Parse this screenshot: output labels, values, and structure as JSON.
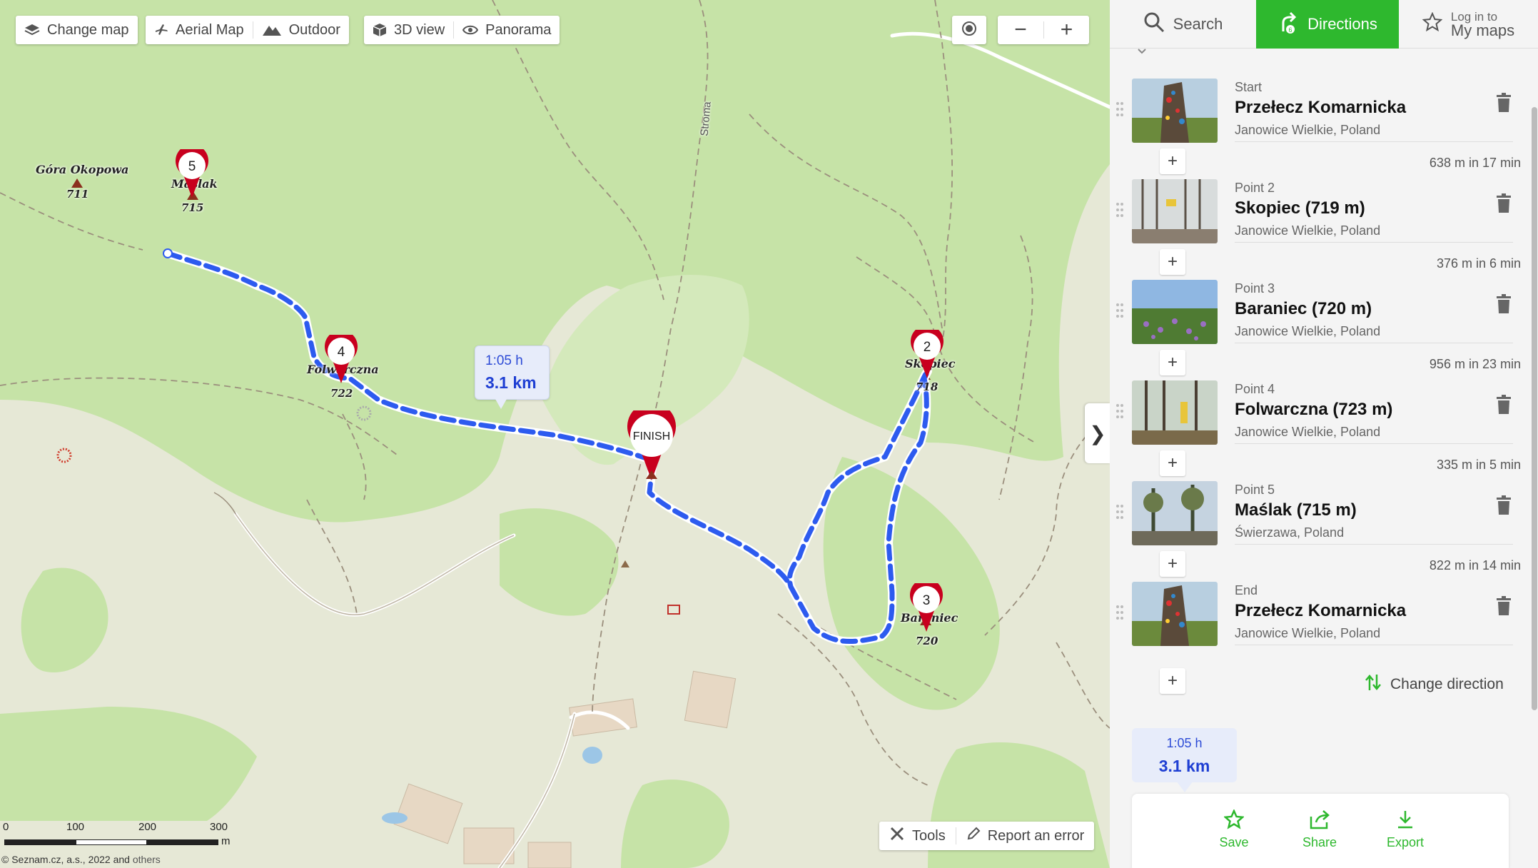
{
  "toolbar": {
    "change_map": "Change map",
    "aerial_map": "Aerial Map",
    "outdoor": "Outdoor",
    "view_3d": "3D view",
    "panorama": "Panorama",
    "zoom_out": "−",
    "zoom_in": "+"
  },
  "map": {
    "labels": {
      "gora_okopowa": "Góra Okopowa",
      "gora_okopowa_elev": "711",
      "maslak": "Maślak",
      "maslak_elev": "715",
      "folwarczna": "Folwarczna",
      "folwarczna_elev": "722",
      "skopiec": "Skopiec",
      "skopiec_elev": "718",
      "baraniec": "Baraniec",
      "baraniec_elev": "720",
      "stroma": "Stroma"
    },
    "markers": [
      "5",
      "4",
      "2",
      "3"
    ],
    "finish_label": "FINISH",
    "route_bubble": {
      "time": "1:05 h",
      "distance": "3.1 km"
    },
    "scale": {
      "ticks": [
        "0",
        "100",
        "200",
        "300"
      ],
      "unit": "m"
    },
    "copyright": "© Seznam.cz, a.s., 2022 and",
    "copyright_link": "others",
    "tools": "Tools",
    "report_error": "Report an error",
    "collapse": "❯"
  },
  "panel": {
    "tabs": {
      "search": "Search",
      "directions": "Directions",
      "login_small": "Log in to",
      "login_big": "My maps"
    },
    "stops": [
      {
        "kind": "Start",
        "name": "Przełecz Komarnicka",
        "place": "Janowice Wielkie, Poland"
      },
      {
        "kind": "Point 2",
        "name": "Skopiec (719 m)",
        "place": "Janowice Wielkie, Poland"
      },
      {
        "kind": "Point 3",
        "name": "Baraniec (720 m)",
        "place": "Janowice Wielkie, Poland"
      },
      {
        "kind": "Point 4",
        "name": "Folwarczna (723 m)",
        "place": "Janowice Wielkie, Poland"
      },
      {
        "kind": "Point 5",
        "name": "Maślak (715 m)",
        "place": "Świerzawa, Poland"
      },
      {
        "kind": "End",
        "name": "Przełecz Komarnicka",
        "place": "Janowice Wielkie, Poland"
      }
    ],
    "segments": [
      "638 m in 17 min",
      "376 m in 6 min",
      "956 m in 23 min",
      "335 m in 5 min",
      "822 m in 14 min"
    ],
    "plus": "+",
    "change_direction": "Change direction",
    "summary": {
      "time": "1:05 h",
      "distance": "3.1 km"
    },
    "actions": {
      "save": "Save",
      "share": "Share",
      "export": "Export"
    }
  },
  "colors": {
    "route": "#2d5bef",
    "accent_green": "#2eb82e",
    "marker_red": "#c8001e",
    "forest": "#c5e2a5"
  }
}
